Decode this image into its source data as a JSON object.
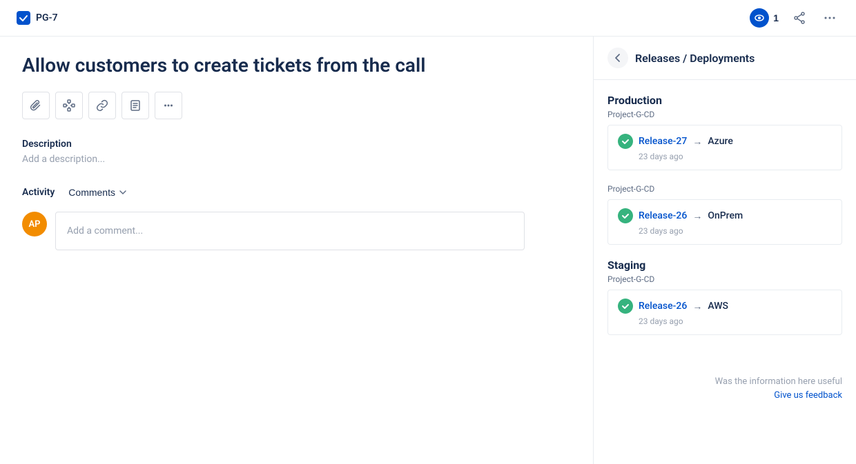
{
  "header": {
    "ticket_id": "PG-7",
    "watch_count": "1",
    "share_label": "share",
    "more_label": "more"
  },
  "issue": {
    "title": "Allow customers to create tickets from the call",
    "description_label": "Description",
    "description_placeholder": "Add a description...",
    "toolbar_items": [
      {
        "name": "attach-icon",
        "symbol": "📎"
      },
      {
        "name": "diagram-icon",
        "symbol": "⎇"
      },
      {
        "name": "link-icon",
        "symbol": "🔗"
      },
      {
        "name": "document-icon",
        "symbol": "📋"
      },
      {
        "name": "more-icon",
        "symbol": "···"
      }
    ]
  },
  "activity": {
    "label": "Activity",
    "filter_label": "Comments",
    "comment_placeholder": "Add a comment...",
    "avatar_initials": "AP"
  },
  "releases": {
    "back_label": "←",
    "title": "Releases / Deployments",
    "environments": [
      {
        "name": "Production",
        "project": "Project-G-CD",
        "releases": [
          {
            "release_name": "Release-27",
            "arrow": "→",
            "target": "Azure",
            "time": "23 days ago"
          }
        ]
      },
      {
        "name": "",
        "project": "Project-G-CD",
        "releases": [
          {
            "release_name": "Release-26",
            "arrow": "→",
            "target": "OnPrem",
            "time": "23 days ago"
          }
        ]
      },
      {
        "name": "Staging",
        "project": "Project-G-CD",
        "releases": [
          {
            "release_name": "Release-26",
            "arrow": "→",
            "target": "AWS",
            "time": "23 days ago"
          }
        ]
      }
    ],
    "feedback_text": "Was the information here useful",
    "feedback_link": "Give us feedback"
  },
  "colors": {
    "accent_blue": "#0052cc",
    "success_green": "#36b37e",
    "avatar_orange": "#f28c00",
    "header_bg": "#0052cc"
  }
}
